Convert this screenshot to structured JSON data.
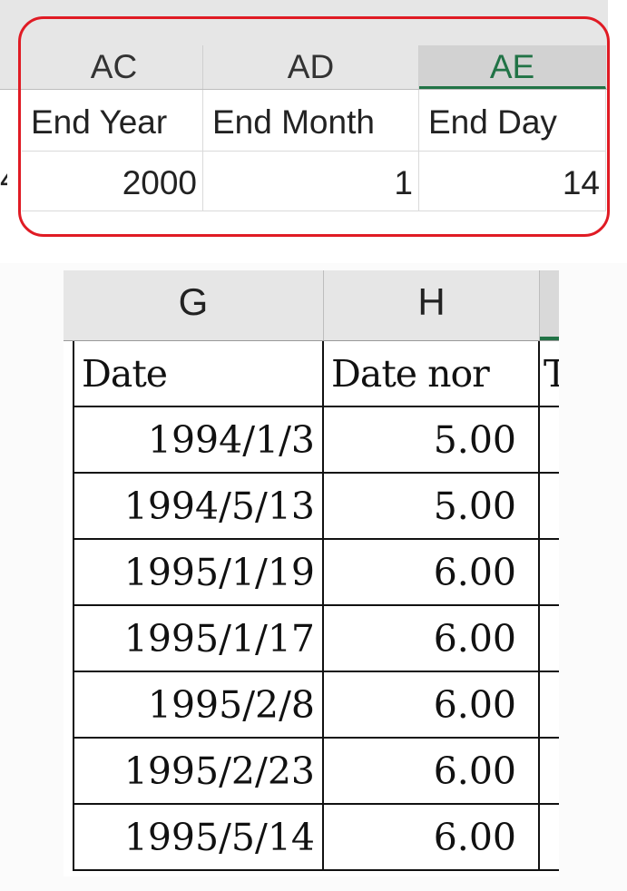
{
  "top_sheet": {
    "columns": [
      "AC",
      "AD",
      "AE"
    ],
    "headers": [
      "End Year",
      "End Month",
      "End Day"
    ],
    "values": [
      "2000",
      "1",
      "14"
    ],
    "left_fragment": "4"
  },
  "bottom_sheet": {
    "columns": [
      "G",
      "H"
    ],
    "headers": [
      "Date",
      "Date nor",
      "T"
    ],
    "rows": [
      {
        "date": "1994/1/3",
        "value": "5.00"
      },
      {
        "date": "1994/5/13",
        "value": "5.00"
      },
      {
        "date": "1995/1/19",
        "value": "6.00"
      },
      {
        "date": "1995/1/17",
        "value": "6.00"
      },
      {
        "date": "1995/2/8",
        "value": "6.00"
      },
      {
        "date": "1995/2/23",
        "value": "6.00"
      },
      {
        "date": "1995/5/14",
        "value": "6.00"
      }
    ]
  },
  "colors": {
    "highlight": "#e01b24",
    "excel_green": "#217346",
    "header_bg": "#e6e6e6"
  }
}
